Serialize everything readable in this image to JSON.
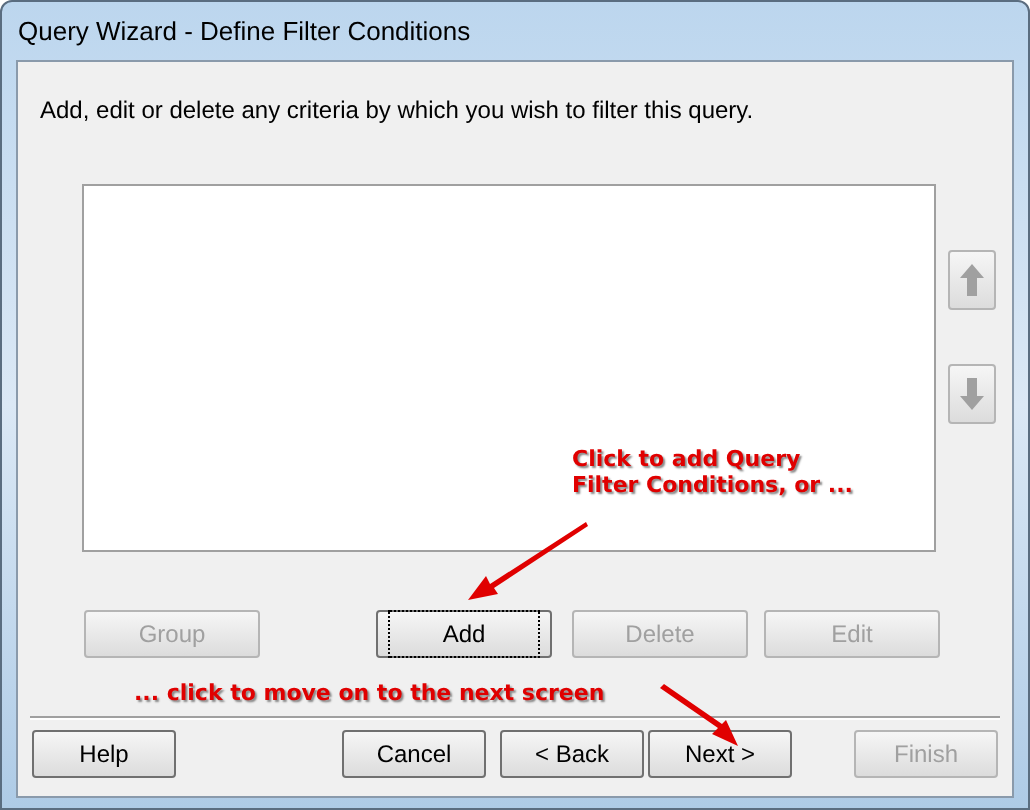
{
  "window": {
    "title": "Query Wizard - Define Filter Conditions"
  },
  "instruction": "Add, edit or delete any criteria by which you wish to filter this query.",
  "move_buttons": [
    {
      "kind": "up",
      "disabled": true
    },
    {
      "kind": "down",
      "disabled": true
    }
  ],
  "action_buttons": [
    {
      "label": "Group",
      "disabled": true,
      "focused": false
    },
    {
      "label": "Add",
      "disabled": false,
      "focused": true
    },
    {
      "label": "Delete",
      "disabled": true,
      "focused": false
    },
    {
      "label": "Edit",
      "disabled": true,
      "focused": false
    }
  ],
  "nav_buttons": [
    {
      "label": "Help",
      "disabled": false
    },
    {
      "label": "Cancel",
      "disabled": false
    },
    {
      "label": "< Back",
      "disabled": false
    },
    {
      "label": "Next >",
      "disabled": false
    },
    {
      "label": "Finish",
      "disabled": true
    }
  ],
  "annotations": [
    {
      "lines": [
        "Click to add Query",
        "Filter Conditions, or ..."
      ]
    },
    {
      "lines": [
        "... click to move on to the next screen"
      ]
    }
  ]
}
